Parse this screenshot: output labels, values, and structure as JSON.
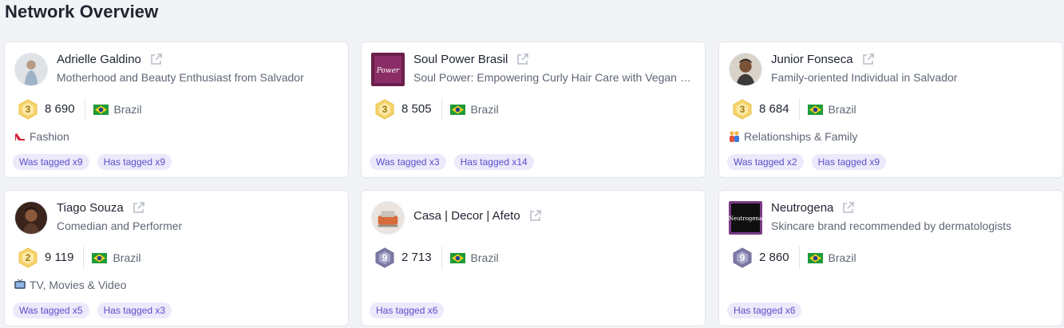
{
  "page": {
    "title": "Network Overview"
  },
  "cards": [
    {
      "name": "Adrielle Galdino",
      "description": "Motherhood and Beauty Enthusiast from Salvador",
      "level": "3",
      "followers": "8 690",
      "country": "Brazil",
      "category": "Fashion",
      "category_icon": "high-heel-icon",
      "tags": [
        "Was tagged x9",
        "Has tagged x9"
      ]
    },
    {
      "name": "Soul Power Brasil",
      "description": "Soul Power: Empowering Curly Hair Care with Vegan Products",
      "level": "3",
      "followers": "8 505",
      "country": "Brazil",
      "logo_text": "Power",
      "tags": [
        "Was tagged x3",
        "Has tagged x14"
      ]
    },
    {
      "name": "Junior Fonseca",
      "description": "Family-oriented Individual in Salvador",
      "level": "3",
      "followers": "8 684",
      "country": "Brazil",
      "category": "Relationships & Family",
      "category_icon": "family-icon",
      "tags": [
        "Was tagged x2",
        "Has tagged x9"
      ]
    },
    {
      "name": "Tiago Souza",
      "description": "Comedian and Performer",
      "level": "2",
      "followers": "9 119",
      "country": "Brazil",
      "category": "TV, Movies & Video",
      "category_icon": "tv-icon",
      "tags": [
        "Was tagged x5",
        "Has tagged x3"
      ]
    },
    {
      "name": "Casa | Decor | Afeto",
      "description": "",
      "level": "9",
      "followers": "2 713",
      "country": "Brazil",
      "tags": [
        "Has tagged x6"
      ]
    },
    {
      "name": "Neutrogena",
      "description": "Skincare brand recommended by dermatologists",
      "level": "9",
      "followers": "2 860",
      "country": "Brazil",
      "logo_text": "Neutrogena",
      "tags": [
        "Has tagged x6"
      ]
    }
  ],
  "colors": {
    "background": "#f1f3f7",
    "tag_bg": "#ece9fb",
    "tag_text": "#5a4fc9",
    "badge_gold": "#f6d36b",
    "badge_purple": "#7e7aa6"
  }
}
